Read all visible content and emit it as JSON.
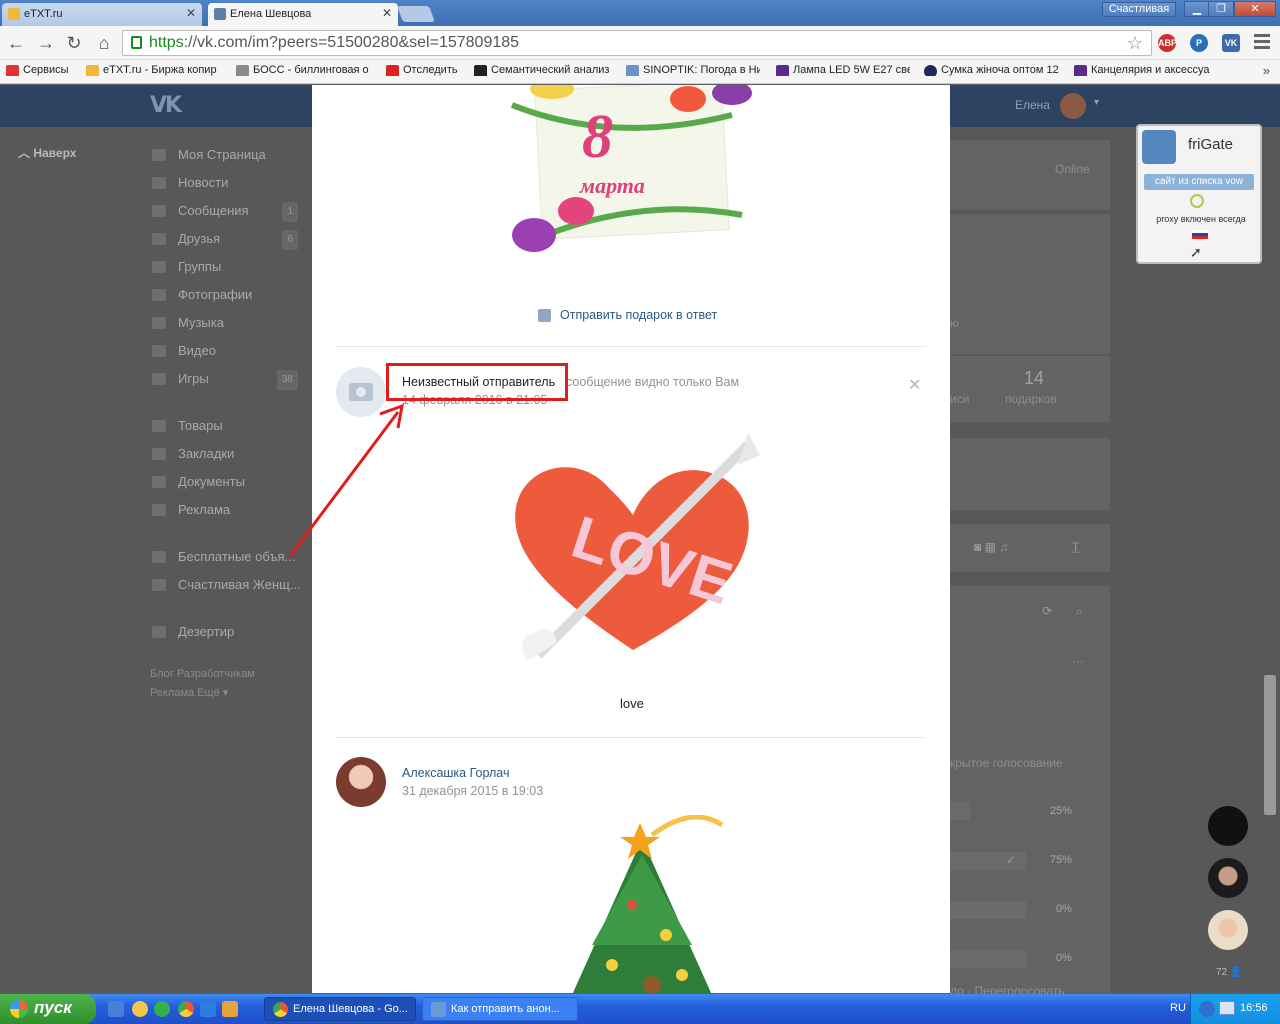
{
  "browser": {
    "tabs": [
      {
        "title": "eTXT.ru",
        "active": false
      },
      {
        "title": "Елена Шевцова",
        "active": true
      }
    ],
    "profile": "Счастливая",
    "url_protocol": "https",
    "url_rest": "://vk.com/im?peers=51500280&sel=157809185",
    "bookmarks": [
      "Сервисы",
      "eTXT.ru - Биржа копир",
      "БОСС - биллинговая о",
      "Отследить",
      "Семантический анализ",
      "SINOPTIK: Погода в Ни",
      "Лампа LED 5W E27 свет",
      "Сумка жіноча оптом 12",
      "Канцелярия и аксессуа"
    ],
    "bookmarks_more": "»"
  },
  "vk": {
    "logo": "VK",
    "user_name": "Елена",
    "naverh": "Наверх",
    "sidebar_main": [
      {
        "label": "Моя Страница",
        "count": ""
      },
      {
        "label": "Новости",
        "count": ""
      },
      {
        "label": "Сообщения",
        "count": "1"
      },
      {
        "label": "Друзья",
        "count": "6"
      },
      {
        "label": "Группы",
        "count": ""
      },
      {
        "label": "Фотографии",
        "count": ""
      },
      {
        "label": "Музыка",
        "count": ""
      },
      {
        "label": "Видео",
        "count": ""
      },
      {
        "label": "Игры",
        "count": "38"
      }
    ],
    "sidebar_secondary": [
      {
        "label": "Товары"
      },
      {
        "label": "Закладки"
      },
      {
        "label": "Документы"
      },
      {
        "label": "Реклама"
      }
    ],
    "sidebar_groups": [
      {
        "label": "Бесплатные объя..."
      },
      {
        "label": "Счастливая Женщ..."
      }
    ],
    "sidebar_apps": [
      {
        "label": "Дезертир"
      }
    ],
    "footer_line1": "Блог   Разработчикам",
    "footer_line2": "Реклама   Ещё ▾",
    "background": {
      "online": "Online",
      "gifts_count": "14",
      "gifts_label": "подарков",
      "records_tail": "иси",
      "to_tail": "ю",
      "poll_title": "крытое голосование",
      "poll_pcts": [
        "25%",
        "75%",
        "0%",
        "0%"
      ],
      "poll_footer": "ло · Переголосовать"
    }
  },
  "modal": {
    "gift1_number": "8",
    "gift1_text": "марта",
    "send_gift_reply": "Отправить подарок в ответ",
    "message1": {
      "sender": "Неизвестный отправитель",
      "visibility": "сообщение видно только Вам",
      "date": "14 февраля 2016 в 21:05",
      "gift_word": "LOVE",
      "caption": "love"
    },
    "message2": {
      "sender": "Алексашка Горлач",
      "date": "31 декабря 2015 в 19:03"
    }
  },
  "frigate": {
    "title": "friGate",
    "button": "сайт из списка vow",
    "note": "proxy включен всегда"
  },
  "rail": {
    "count": "72"
  },
  "taskbar": {
    "start": "пуск",
    "tasks": [
      "Елена Шевцова - Go...",
      "Как отправить анон..."
    ],
    "lang": "RU",
    "time": "16:56"
  },
  "colors": {
    "vk_header": "#2c4462",
    "link": "#2a5885",
    "highlight_box": "#e01c1c",
    "annotation_arrow": "#e01c1c"
  }
}
